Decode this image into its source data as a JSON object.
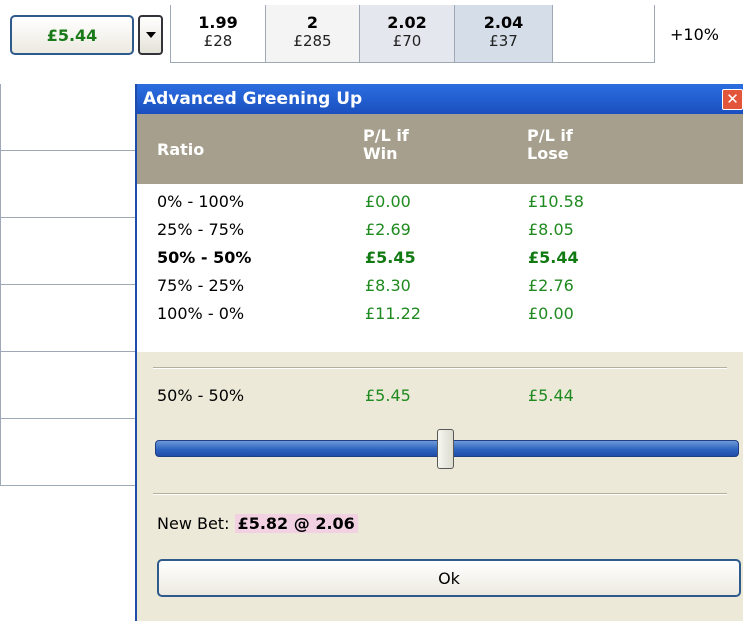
{
  "ladder": {
    "green_button": "£5.44",
    "cells": [
      {
        "odds": "1.99",
        "amount": "£28"
      },
      {
        "odds": "2",
        "amount": "£285"
      },
      {
        "odds": "2.02",
        "amount": "£70"
      },
      {
        "odds": "2.04",
        "amount": "£37"
      }
    ],
    "percent": "+10%"
  },
  "dialog": {
    "title": "Advanced Greening Up",
    "close_icon": "close-icon",
    "columns": {
      "ratio": "Ratio",
      "win": "P/L if Win",
      "lose": "P/L if Lose"
    },
    "rows": [
      {
        "ratio": "0% - 100%",
        "win": "£0.00",
        "lose": "£10.58",
        "selected": false
      },
      {
        "ratio": "25% - 75%",
        "win": "£2.69",
        "lose": "£8.05",
        "selected": false
      },
      {
        "ratio": "50% - 50%",
        "win": "£5.45",
        "lose": "£5.44",
        "selected": true
      },
      {
        "ratio": "75% - 25%",
        "win": "£8.30",
        "lose": "£2.76",
        "selected": false
      },
      {
        "ratio": "100% - 0%",
        "win": "£11.22",
        "lose": "£0.00",
        "selected": false
      }
    ],
    "summary": {
      "ratio": "50% - 50%",
      "win": "£5.45",
      "lose": "£5.44"
    },
    "slider_value_percent": 50,
    "new_bet_label": "New Bet:",
    "new_bet_value": "£5.82 @ 2.06",
    "ok_label": "Ok"
  },
  "colors": {
    "title_bar": "#1b4fbf",
    "header_bg": "#a69f8d",
    "profit_green": "#1f8a1f",
    "new_bet_highlight": "#f2d2e2"
  }
}
